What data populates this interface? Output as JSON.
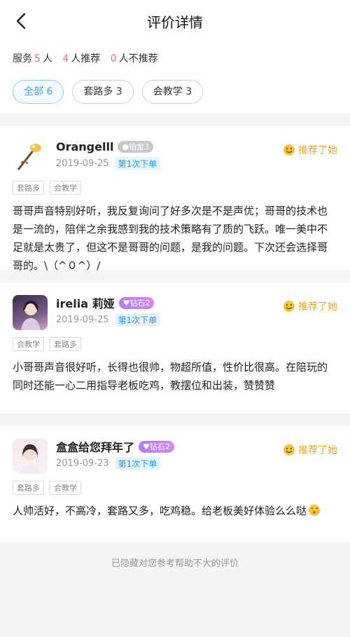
{
  "header": {
    "title": "评价详情",
    "back_icon": "chevron-left-icon"
  },
  "summary": {
    "service_label": "服务",
    "service_count": "5",
    "service_unit": "人",
    "recommend_count": "4",
    "recommend_label": "人推荐",
    "not_recommend_count": "0",
    "not_recommend_label": "人不推荐"
  },
  "filters": [
    {
      "label": "全部 6",
      "active": true
    },
    {
      "label": "套路多 3",
      "active": false
    },
    {
      "label": "会教学 3",
      "active": false
    }
  ],
  "reviews": [
    {
      "name": "Orangelll",
      "tier": "铂金3",
      "date": "2019-09-25",
      "order_tag": "第1次下单",
      "recommend": "推荐了她",
      "tags": [
        "套路多",
        "会教学"
      ],
      "content": "哥哥声音特别好听，我反复询问了好多次是不是声优；哥哥的技术也是一流的，陪伴之余我感到我的技术策略有了质的飞跃。唯一美中不足就是太贵了，但这不是哥哥的问题，是我的问题。下次还会选择哥哥的。\\（^０^）/"
    },
    {
      "name": "irelia 莉娅",
      "tier": "钻石2",
      "date": "2019-09-25",
      "order_tag": "第1次下单",
      "recommend": "推荐了她",
      "tags": [
        "会教学",
        "套路多"
      ],
      "content": "小哥哥声音很好听，长得也很帅，物超所值，性价比很高。在陪玩的同时还能一心二用指导老板吃鸡，教摆位和出装，赞赞赞"
    },
    {
      "name": "盒盒给您拜年了",
      "tier": "钻石2",
      "date": "2019-09-23",
      "order_tag": "第1次下单",
      "recommend": "推荐了她",
      "tags": [
        "套路多",
        "会教学"
      ],
      "content": "人帅活好，不高冷，套路又多，吃鸡稳。给老板美好体验么么哒"
    }
  ],
  "footer": {
    "text": "已隐藏对您参考帮助不大的评价"
  },
  "colors": {
    "accent_blue": "#3aa6e6",
    "number_red": "#ef6d5e",
    "recommend_orange": "#f0a32c",
    "tier_purple": "#c07ff3"
  }
}
